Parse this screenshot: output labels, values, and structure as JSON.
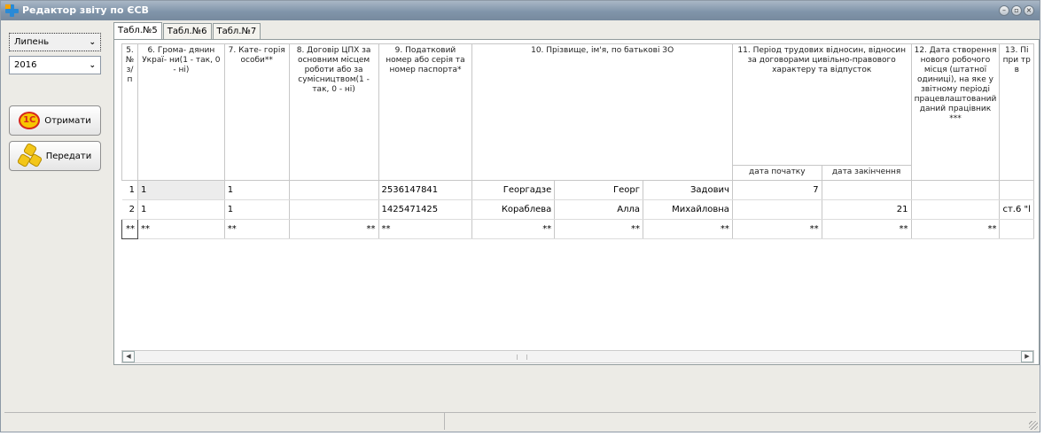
{
  "window": {
    "title": "Редактор звіту по ЄСВ",
    "accent": "#7f93a8"
  },
  "sidebar": {
    "month_select": {
      "value": "Липень"
    },
    "year_select": {
      "value": "2016"
    },
    "get_button": {
      "label": "Отримати",
      "icon": "1c-logo-icon",
      "icon_text": "1С"
    },
    "send_button": {
      "label": "Передати",
      "icon": "honeycomb-icon"
    }
  },
  "tabs": [
    {
      "label": "Табл.№5",
      "active": true
    },
    {
      "label": "Табл.№6",
      "active": false
    },
    {
      "label": "Табл.№7",
      "active": false
    }
  ],
  "table": {
    "headers": {
      "c5": "5. № з/п",
      "c6": "6. Грома- дянин Украї- ни(1 - так, 0 - ні)",
      "c7": "7. Кате- горія особи**",
      "c8": "8. Договір ЦПХ за основним місцем роботи або за сумісництвом(1 - так, 0 - ні)",
      "c9": "9. Податковий номер або серія та номер паспорта*",
      "c10": "10. Прізвище, ім'я, по батькові ЗО",
      "c11": "11. Період трудових відносин, відносин за договорами цивільно-правового характеру та відпусток",
      "c11a": "дата початку",
      "c11b": "дата закінчення",
      "c12": "12. Дата створення нового робочого місця (штатної одиниці), на яке у звітному періоді працевлаштований даний працівник ***",
      "c13": "13. Пі при тр в"
    },
    "rows": [
      {
        "n": "1",
        "citizen": "1",
        "category": "1",
        "gph": "",
        "tax": "2536147841",
        "surname": "Георгадзе",
        "name": "Георг",
        "patronymic": "Задович",
        "start": "7",
        "end": "",
        "newplace": "",
        "c13": ""
      },
      {
        "n": "2",
        "citizen": "1",
        "category": "1",
        "gph": "",
        "tax": "1425471425",
        "surname": "Кораблева",
        "name": "Алла",
        "patronymic": "Михайловна",
        "start": "",
        "end": "21",
        "newplace": "",
        "c13": "ст.6 \"l"
      },
      {
        "n": "**",
        "citizen": "**",
        "category": "**",
        "gph": "**",
        "tax": "**",
        "surname": "**",
        "name": "**",
        "patronymic": "**",
        "start": "**",
        "end": "**",
        "newplace": "**",
        "c13": ""
      }
    ]
  },
  "statusbar": {
    "left": "",
    "right": ""
  }
}
